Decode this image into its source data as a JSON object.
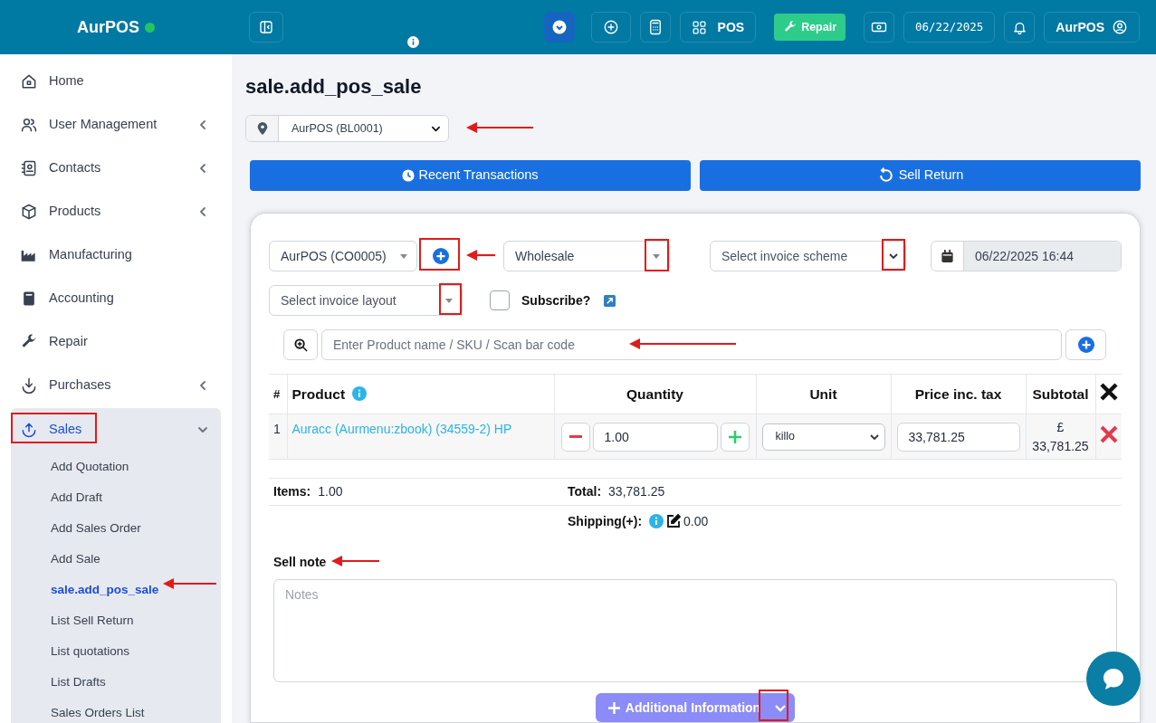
{
  "brand": {
    "name": "AurPOS",
    "online": true
  },
  "header": {
    "pos_label": "POS",
    "repair_label": "Repair",
    "date": "06/22/2025",
    "user": "AurPOS"
  },
  "sidebar": {
    "items": [
      {
        "label": "Home",
        "expandable": false,
        "expanded": false,
        "selected": false
      },
      {
        "label": "User Management",
        "expandable": true,
        "expanded": false,
        "selected": false
      },
      {
        "label": "Contacts",
        "expandable": true,
        "expanded": false,
        "selected": false
      },
      {
        "label": "Products",
        "expandable": true,
        "expanded": false,
        "selected": false
      },
      {
        "label": "Manufacturing",
        "expandable": false,
        "expanded": false,
        "selected": false
      },
      {
        "label": "Accounting",
        "expandable": false,
        "expanded": false,
        "selected": false
      },
      {
        "label": "Repair",
        "expandable": false,
        "expanded": false,
        "selected": false
      },
      {
        "label": "Purchases",
        "expandable": true,
        "expanded": false,
        "selected": false
      },
      {
        "label": "Sales",
        "expandable": true,
        "expanded": true,
        "selected": true,
        "children": [
          {
            "label": "Add Quotation",
            "selected": false
          },
          {
            "label": "Add Draft",
            "selected": false
          },
          {
            "label": "Add Sales Order",
            "selected": false
          },
          {
            "label": "Add Sale",
            "selected": false
          },
          {
            "label": "sale.add_pos_sale",
            "selected": true
          },
          {
            "label": "List Sell Return",
            "selected": false
          },
          {
            "label": "List quotations",
            "selected": false
          },
          {
            "label": "List Drafts",
            "selected": false
          },
          {
            "label": "Sales Orders List",
            "selected": false
          }
        ]
      }
    ]
  },
  "page": {
    "title": "sale.add_pos_sale",
    "location": "AurPOS (BL0001)",
    "buttons": [
      "Recent Transactions",
      "Sell Return"
    ]
  },
  "form": {
    "customer": "AurPOS (CO0005)",
    "price_group": "Wholesale",
    "invoice_scheme": {
      "placeholder": "Select invoice scheme"
    },
    "transaction_date": "06/22/2025 16:44",
    "invoice_layout": {
      "placeholder": "Select invoice layout"
    },
    "subscribe": {
      "label": "Subscribe?",
      "checked": false
    },
    "search": {
      "placeholder": "Enter Product name / SKU / Scan bar code"
    }
  },
  "table": {
    "columns": [
      "#",
      "Product",
      "Quantity",
      "Unit",
      "Price inc. tax",
      "Subtotal"
    ],
    "rows": [
      {
        "number": "1",
        "product": "Auracc (Aurmenu:zbook) (34559-2) HP",
        "quantity": "1.00",
        "unit": "killo",
        "price": "33,781.25",
        "subtotal": "£ 33,781.25"
      }
    ]
  },
  "totals": {
    "items_label": "Items:",
    "items": "1.00",
    "total_label": "Total:",
    "total": "33,781.25",
    "shipping_label": "Shipping(+):",
    "shipping": "0.00"
  },
  "sell_note": {
    "label": "Sell note",
    "placeholder": "Notes"
  },
  "additional_info": {
    "label": "Additional Information"
  }
}
